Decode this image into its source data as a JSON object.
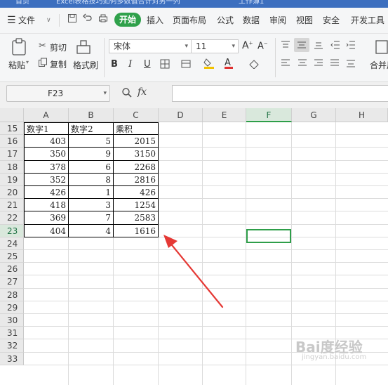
{
  "titlebar": {
    "home_tab": "首页",
    "doc_tab": "Excel表格技巧如何多数值合计对另一列",
    "new_tab": "工作簿1"
  },
  "menubar": {
    "hamburger": "☰",
    "file_label": "文件",
    "active_tab": "开始",
    "tabs": [
      "插入",
      "页面布局",
      "公式",
      "数据",
      "审阅",
      "视图",
      "安全",
      "开发工具"
    ]
  },
  "ribbon": {
    "paste": "粘贴",
    "cut": "剪切",
    "copy": "复制",
    "format_painter": "格式刷",
    "font_name": "宋体",
    "font_size": "11",
    "bold": "B",
    "italic": "I",
    "underline": "U",
    "merge": "合并居中"
  },
  "formula_bar": {
    "cell_ref": "F23",
    "fx": "fx",
    "value": ""
  },
  "sheet": {
    "columns": [
      "A",
      "B",
      "C",
      "D",
      "E",
      "F",
      "G",
      "H"
    ],
    "active_column": "F",
    "active_row": "23",
    "row_numbers": [
      "15",
      "16",
      "17",
      "18",
      "19",
      "20",
      "21",
      "22",
      "23",
      "24",
      "25",
      "26",
      "27",
      "28",
      "29",
      "30",
      "31",
      "32",
      "33"
    ],
    "headers": [
      "数字1",
      "数字2",
      "乘积"
    ],
    "rows": [
      [
        "403",
        "5",
        "2015"
      ],
      [
        "350",
        "9",
        "3150"
      ],
      [
        "378",
        "6",
        "2268"
      ],
      [
        "352",
        "8",
        "2816"
      ],
      [
        "426",
        "1",
        "426"
      ],
      [
        "418",
        "3",
        "1254"
      ],
      [
        "369",
        "7",
        "2583"
      ],
      [
        "404",
        "4",
        "1616"
      ]
    ]
  },
  "annotation": {
    "arrow_color": "#e53935"
  },
  "watermark": {
    "main": "Bai度经验",
    "sub": "jingyan.baidu.com"
  }
}
